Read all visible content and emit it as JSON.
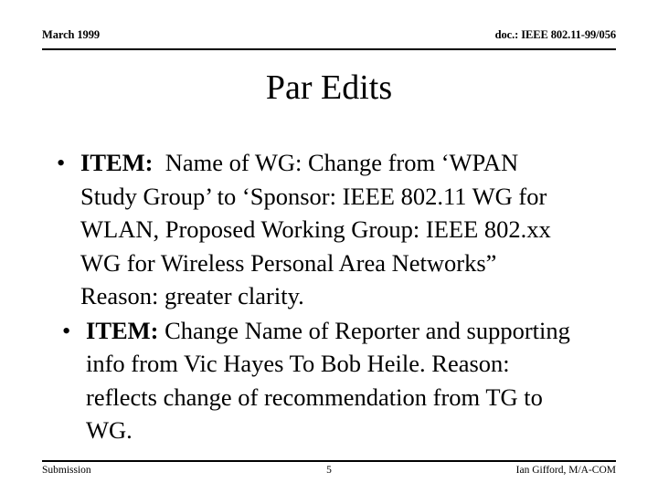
{
  "slide": {
    "header": {
      "left": "March 1999",
      "right": "doc.: IEEE 802.11-99/056"
    },
    "title": "Par Edits",
    "bullets": [
      {
        "marker": "•",
        "lead": "ITEM:",
        "lines": [
          "Name of WG:  Change from ‘WPAN",
          "Study Group’ to ‘Sponsor:  IEEE 802.11 WG for",
          "WLAN, Proposed Working Group:  IEEE 802.xx",
          "WG for Wireless Personal Area Networks”",
          "Reason: greater clarity."
        ]
      },
      {
        "marker": "•",
        "lead": "ITEM:",
        "lines": [
          "Change Name of Reporter and supporting",
          "info from Vic Hayes To Bob Heile.   Reason:",
          "reflects change of recommendation from TG to",
          "WG."
        ]
      }
    ],
    "footer": {
      "left": "Submission",
      "center": "5",
      "right": "Ian Gifford, M/A-COM"
    }
  }
}
